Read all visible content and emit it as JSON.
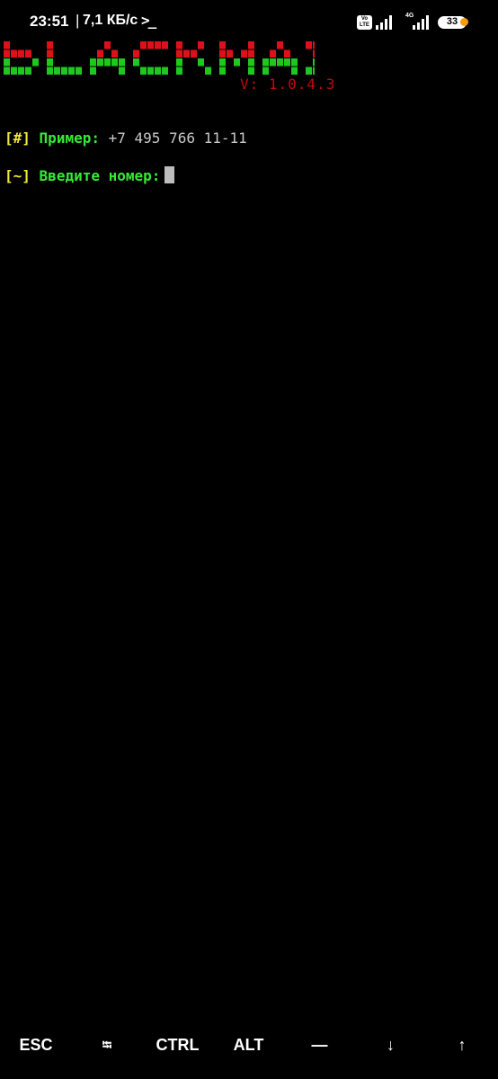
{
  "status_bar": {
    "time": "23:51",
    "separator": "|",
    "speed": "7,1 КБ/с",
    "terminal_icon": "terminal-icon",
    "volte": "Vo LTE",
    "network": "4G",
    "battery": "33",
    "battery_dot_color": "#f39c12"
  },
  "app": {
    "logo_text": "BLACKMAIL",
    "logo_colors": {
      "top": "#e0101a",
      "bottom": "#1ec81e"
    },
    "version": "V: 1.0.4.3"
  },
  "terminal": {
    "lines": [
      {
        "prefix": "[#]",
        "label": "Пример:",
        "value": "+7 495 766 11-11"
      },
      {
        "prefix": "[~]",
        "label": "Введите номер:",
        "value": ""
      }
    ]
  },
  "extra_keys": [
    "ESC",
    "⭾",
    "CTRL",
    "ALT",
    "—",
    "↓",
    "↑"
  ]
}
